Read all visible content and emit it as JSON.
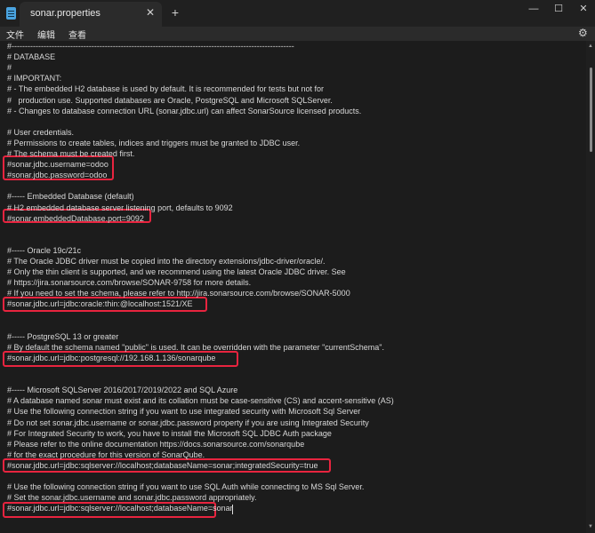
{
  "tab": {
    "title": "sonar.properties"
  },
  "menu": {
    "file": "文件",
    "edit": "编辑",
    "view": "查看"
  },
  "window": {
    "minimize": "—",
    "maximize": "☐",
    "close": "✕"
  },
  "editor": {
    "lines": [
      "#----------------------------------------------------------------------------------------------------------",
      "# DATABASE",
      "#",
      "# IMPORTANT:",
      "# - The embedded H2 database is used by default. It is recommended for tests but not for",
      "#   production use. Supported databases are Oracle, PostgreSQL and Microsoft SQLServer.",
      "# - Changes to database connection URL (sonar.jdbc.url) can affect SonarSource licensed products.",
      "",
      "# User credentials.",
      "# Permissions to create tables, indices and triggers must be granted to JDBC user.",
      "# The schema must be created first.",
      "#sonar.jdbc.username=odoo",
      "#sonar.jdbc.password=odoo",
      "",
      "#----- Embedded Database (default)",
      "# H2 embedded database server listening port, defaults to 9092",
      "#sonar.embeddedDatabase.port=9092",
      "",
      "",
      "#----- Oracle 19c/21c",
      "# The Oracle JDBC driver must be copied into the directory extensions/jdbc-driver/oracle/.",
      "# Only the thin client is supported, and we recommend using the latest Oracle JDBC driver. See",
      "# https://jira.sonarsource.com/browse/SONAR-9758 for more details.",
      "# If you need to set the schema, please refer to http://jira.sonarsource.com/browse/SONAR-5000",
      "#sonar.jdbc.url=jdbc:oracle:thin:@localhost:1521/XE",
      "",
      "",
      "#----- PostgreSQL 13 or greater",
      "# By default the schema named \"public\" is used. It can be overridden with the parameter \"currentSchema\".",
      "#sonar.jdbc.url=jdbc:postgresql://192.168.1.136/sonarqube",
      "",
      "",
      "#----- Microsoft SQLServer 2016/2017/2019/2022 and SQL Azure",
      "# A database named sonar must exist and its collation must be case-sensitive (CS) and accent-sensitive (AS)",
      "# Use the following connection string if you want to use integrated security with Microsoft Sql Server",
      "# Do not set sonar.jdbc.username or sonar.jdbc.password property if you are using Integrated Security",
      "# For Integrated Security to work, you have to install the Microsoft SQL JDBC Auth package",
      "# Please refer to the online documentation https://docs.sonarsource.com/sonarqube",
      "# for the exact procedure for this version of SonarQube.",
      "#sonar.jdbc.url=jdbc:sqlserver://localhost;databaseName=sonar;integratedSecurity=true",
      "",
      "# Use the following connection string if you want to use SQL Auth while connecting to MS Sql Server.",
      "# Set the sonar.jdbc.username and sonar.jdbc.password appropriately.",
      "#sonar.jdbc.url=jdbc:sqlserver://localhost;databaseName=sonar"
    ]
  },
  "highlight_color": "#e8243f"
}
